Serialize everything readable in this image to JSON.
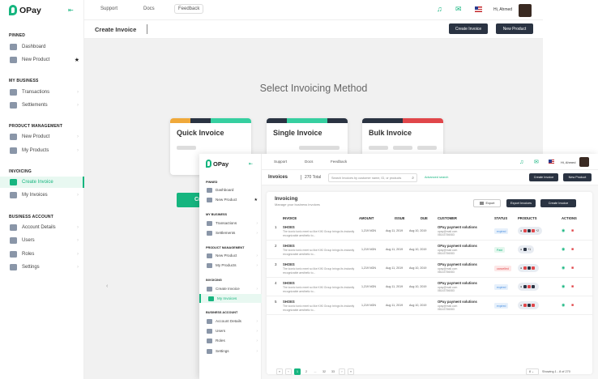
{
  "brand": {
    "name": "OPay",
    "accent": "#16b57f"
  },
  "sidebar": {
    "sections": [
      {
        "label": "PINNED",
        "items": [
          {
            "label": "Dashboard"
          },
          {
            "label": "New Product"
          }
        ]
      },
      {
        "label": "MY BUSINESS",
        "items": [
          {
            "label": "Transactions"
          },
          {
            "label": "Settlements"
          }
        ]
      },
      {
        "label": "PRODUCT MANAGEMENT",
        "items": [
          {
            "label": "New Product"
          },
          {
            "label": "My Products"
          }
        ]
      },
      {
        "label": "INVOICING",
        "items": [
          {
            "label": "Create Invoice"
          },
          {
            "label": "My Invoices"
          }
        ]
      },
      {
        "label": "BUSINESS ACCOUNT",
        "items": [
          {
            "label": "Account Details"
          },
          {
            "label": "Users"
          },
          {
            "label": "Roles"
          },
          {
            "label": "Settings"
          }
        ]
      }
    ]
  },
  "topnav": {
    "support": "Support",
    "docs": "Docs",
    "feedback": "Feedback",
    "greeting": "Hi, Ahmed"
  },
  "background_page": {
    "title": "Create Invoice",
    "btn_create_invoice": "Create Invoice",
    "btn_new_product": "New Product",
    "heading": "Select Invoicing Method",
    "cards": [
      {
        "label": "Quick Invoice"
      },
      {
        "label": "Single Invoice"
      },
      {
        "label": "Bulk Invoice"
      }
    ],
    "create_btn_fragment": "Cr"
  },
  "foreground_page": {
    "greeting": "Hi, Ahmed",
    "title": "Invoices",
    "total": "270 Total",
    "search_placeholder": "Search Invoices by customer name, ID, or products",
    "advanced_search": "Advanced search",
    "btn_create_invoice": "Create Invoice",
    "btn_new_product": "New Product",
    "panel": {
      "title": "Invoicing",
      "subtitle": "Manage your business invoices",
      "btn_export": "Export",
      "btn_export_invoices": "Export Invoices",
      "btn_create_invoice": "Create Invoice"
    },
    "columns": [
      "INVOICE",
      "AMOUNT",
      "ISSUE",
      "DUE",
      "CUSTOMER",
      "STATUS",
      "PRODUCTS",
      "ACTIONS"
    ],
    "rows": [
      {
        "num": "1",
        "invoice": "SHOES",
        "desc": "The iconic tonic meet so like KIKI Group brings its instantly recognizable aesthetic to...",
        "amount": "1,219 NGN",
        "issue": "Aug 11, 2019",
        "due": "Aug 10, 2019",
        "customer": "OPay payment solutions",
        "email": "opay@mail.com",
        "phone": "08143756083",
        "status": "expired",
        "status_color": "#4a90e2",
        "status_bg": "#e6f0fb",
        "products": "+2"
      },
      {
        "num": "2",
        "invoice": "SHOES",
        "desc": "The iconic tonic meet so like KIKI Group brings its instantly recognizable aesthetic to...",
        "amount": "1,219 NGN",
        "issue": "Aug 11, 2019",
        "due": "Aug 10, 2019",
        "customer": "OPay payment solutions",
        "email": "opay@mail.com",
        "phone": "08143756083",
        "status": "Paid",
        "status_color": "#16b57f",
        "status_bg": "#e4f7ee",
        "products": "+1"
      },
      {
        "num": "3",
        "invoice": "SHOES",
        "desc": "The iconic tonic meet so like KIKI Group brings its instantly recognizable aesthetic to...",
        "amount": "1,219 NGN",
        "issue": "Aug 11, 2019",
        "due": "Aug 10, 2019",
        "customer": "OPay payment solutions",
        "email": "opay@mail.com",
        "phone": "08143756083",
        "status": "cancelled",
        "status_color": "#e0464a",
        "status_bg": "#fde7e7",
        "products": ""
      },
      {
        "num": "4",
        "invoice": "SHOES",
        "desc": "The iconic tonic meet so like KIKI Group brings its instantly recognizable aesthetic to...",
        "amount": "1,219 NGN",
        "issue": "Aug 11, 2019",
        "due": "Aug 10, 2019",
        "customer": "OPay payment solutions",
        "email": "opay@mail.com",
        "phone": "08143756083",
        "status": "expired",
        "status_color": "#4a90e2",
        "status_bg": "#e6f0fb",
        "products": ""
      },
      {
        "num": "5",
        "invoice": "SHOES",
        "desc": "The iconic tonic meet so like KIKI Group brings its instantly recognizable aesthetic to...",
        "amount": "1,219 NGN",
        "issue": "Aug 11, 2019",
        "due": "Aug 10, 2019",
        "customer": "OPay payment solutions",
        "email": "opay@mail.com",
        "phone": "08143756083",
        "status": "expired",
        "status_color": "#4a90e2",
        "status_bg": "#e6f0fb",
        "products": ""
      }
    ],
    "pagination": {
      "pages": [
        "1",
        "2",
        "...",
        "32",
        "33"
      ],
      "current": "1",
      "per_page": "8",
      "showing": "Showing 1 - 8 of 270"
    }
  }
}
